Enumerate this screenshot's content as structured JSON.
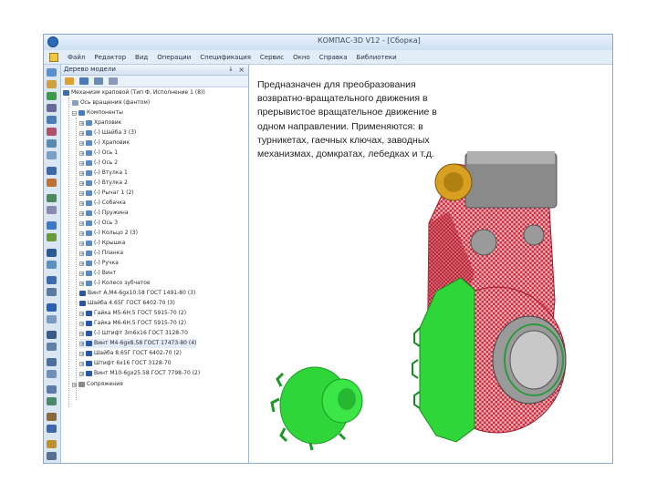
{
  "window": {
    "title": "КОМПАС-3D V12 - [Сборка]"
  },
  "menu": {
    "items": [
      "Файл",
      "Редактор",
      "Вид",
      "Операции",
      "Спецификация",
      "Сервис",
      "Окно",
      "Справка",
      "Библиотеки"
    ]
  },
  "tree_panel": {
    "header": "Дерево модели",
    "pin": "↓",
    "close": "×",
    "nodes": [
      "Механизм храповой (Тип Ф, Исполнение 1 (8))",
      "Ось вращения (фантом)",
      "Компоненты",
      "Храповик",
      "(-) Шайба 3 (3)",
      "(-) Храповик",
      "(-) Ось 1",
      "(-) Ось 2",
      "(-) Втулка 1",
      "(-) Втулка 2",
      "(-) Рычаг 1 (2)",
      "(-) Собачка",
      "(-) Пружина",
      "(-) Ось 3",
      "(-) Кольцо 2 (3)",
      "(-) Крышка",
      "(-) Планка",
      "(-) Ручка",
      "(-) Винт",
      "(-) Колесо зубчатое",
      "Винт A.M4-6gx10.58 ГОСТ 1491-80 (3)",
      "Шайба 4.65Г ГОСТ 6402-70 (3)",
      "Гайка M5-6H.5 ГОСТ 5915-70 (2)",
      "Гайка M6-6H.5 ГОСТ 5915-70 (2)",
      "(-) Штифт 3m6x16 ГОСТ 3128-70",
      "Винт M4-6gx8.58 ГОСТ 17473-80 (4)",
      "Шайба 8.65Г ГОСТ 6402-70 (2)",
      "Штифт 6x16 ГОСТ 3128-70",
      "Винт M10-6gx25.58 ГОСТ 7798-70 (2)",
      "Сопряжения"
    ]
  },
  "description": "Предназначен для преобразования возвратно-вращательного движения в прерывистое вращательное движение в одном направлении. Применяются: в турникетах, гаечных ключах, заводных механизмах, домкратах, лебедках и т.д.",
  "colors": {
    "body_red": "#c8283a",
    "gear_green": "#2fd63a",
    "pawl_gray": "#8a8a8a",
    "nut_yellow": "#e8b020"
  }
}
